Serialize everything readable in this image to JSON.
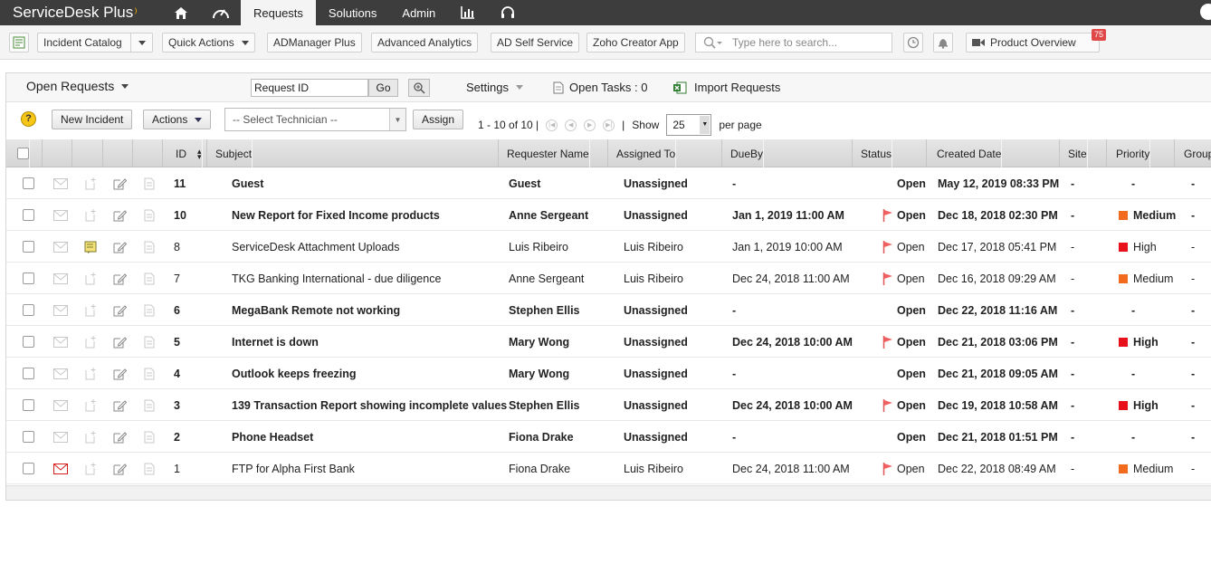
{
  "app": {
    "title": "ServiceDesk Plus"
  },
  "nav": {
    "tabs": [
      {
        "label": "Requests",
        "active": true
      },
      {
        "label": "Solutions"
      },
      {
        "label": "Admin"
      }
    ],
    "icons": [
      "home-icon",
      "dashboard-icon",
      "reports-icon",
      "support-icon"
    ]
  },
  "toolbar": {
    "incident_catalog": "Incident Catalog",
    "quick_actions": "Quick Actions",
    "admanager": "ADManager Plus",
    "advanced_analytics": "Advanced Analytics",
    "ad_self_service": "AD Self Service",
    "zoho_creator": "Zoho Creator App",
    "search_placeholder": "Type here to search...",
    "product_overview": "Product Overview",
    "notification_count": "75"
  },
  "panel": {
    "view_title": "Open Requests",
    "request_id_value": "Request ID",
    "go_label": "Go",
    "settings_label": "Settings",
    "open_tasks": "Open Tasks : 0",
    "import_requests": "Import Requests"
  },
  "actions": {
    "new_incident": "New Incident",
    "actions_label": "Actions",
    "technician_placeholder": "-- Select Technician --",
    "assign_label": "Assign",
    "page_info": "1 - 10 of 10",
    "show_label": "Show",
    "per_page_value": "25",
    "per_page_label": "per page"
  },
  "table": {
    "columns": {
      "id": "ID",
      "subject": "Subject",
      "requester": "Requester Name",
      "assigned": "Assigned To",
      "dueby": "DueBy",
      "status": "Status",
      "created": "Created Date",
      "site": "Site",
      "priority": "Priority",
      "group": "Group"
    },
    "rows": [
      {
        "id": "11",
        "subject": "Guest",
        "requester": "Guest",
        "assigned": "Unassigned",
        "dueby": "-",
        "flag": false,
        "status": "Open",
        "created": "May 12, 2019 08:33 PM",
        "site": "-",
        "priority": "-",
        "priority_color": "",
        "group": "-",
        "unread": true,
        "mail_red": false,
        "note": false
      },
      {
        "id": "10",
        "subject": "New Report for Fixed Income products",
        "requester": "Anne Sergeant",
        "assigned": "Unassigned",
        "dueby": "Jan 1, 2019 11:00 AM",
        "flag": true,
        "status": "Open",
        "created": "Dec 18, 2018 02:30 PM",
        "site": "-",
        "priority": "Medium",
        "priority_color": "#f26b1d",
        "group": "-",
        "unread": true,
        "mail_red": false,
        "note": false
      },
      {
        "id": "8",
        "subject": "ServiceDesk Attachment Uploads",
        "requester": "Luis Ribeiro",
        "assigned": "Luis Ribeiro",
        "dueby": "Jan 1, 2019 10:00 AM",
        "flag": true,
        "status": "Open",
        "created": "Dec 17, 2018 05:41 PM",
        "site": "-",
        "priority": "High",
        "priority_color": "#e8101a",
        "group": "-",
        "unread": false,
        "mail_red": false,
        "note": true
      },
      {
        "id": "7",
        "subject": "TKG Banking International - due diligence",
        "requester": "Anne Sergeant",
        "assigned": "Luis Ribeiro",
        "dueby": "Dec 24, 2018 11:00 AM",
        "flag": true,
        "status": "Open",
        "created": "Dec 16, 2018 09:29 AM",
        "site": "-",
        "priority": "Medium",
        "priority_color": "#f26b1d",
        "group": "-",
        "unread": false,
        "mail_red": false,
        "note": false
      },
      {
        "id": "6",
        "subject": "MegaBank Remote not working",
        "requester": "Stephen Ellis",
        "assigned": "Unassigned",
        "dueby": "-",
        "flag": false,
        "status": "Open",
        "created": "Dec 22, 2018 11:16 AM",
        "site": "-",
        "priority": "-",
        "priority_color": "",
        "group": "-",
        "unread": true,
        "mail_red": false,
        "note": false
      },
      {
        "id": "5",
        "subject": "Internet is down",
        "requester": "Mary Wong",
        "assigned": "Unassigned",
        "dueby": "Dec 24, 2018 10:00 AM",
        "flag": true,
        "status": "Open",
        "created": "Dec 21, 2018 03:06 PM",
        "site": "-",
        "priority": "High",
        "priority_color": "#e8101a",
        "group": "-",
        "unread": true,
        "mail_red": false,
        "note": false
      },
      {
        "id": "4",
        "subject": "Outlook keeps freezing",
        "requester": "Mary Wong",
        "assigned": "Unassigned",
        "dueby": "-",
        "flag": false,
        "status": "Open",
        "created": "Dec 21, 2018 09:05 AM",
        "site": "-",
        "priority": "-",
        "priority_color": "",
        "group": "-",
        "unread": true,
        "mail_red": false,
        "note": false
      },
      {
        "id": "3",
        "subject": "139 Transaction Report showing incomplete values",
        "requester": "Stephen Ellis",
        "assigned": "Unassigned",
        "dueby": "Dec 24, 2018 10:00 AM",
        "flag": true,
        "status": "Open",
        "created": "Dec 19, 2018 10:58 AM",
        "site": "-",
        "priority": "High",
        "priority_color": "#e8101a",
        "group": "-",
        "unread": true,
        "mail_red": false,
        "note": false
      },
      {
        "id": "2",
        "subject": "Phone Headset",
        "requester": "Fiona Drake",
        "assigned": "Unassigned",
        "dueby": "-",
        "flag": false,
        "status": "Open",
        "created": "Dec 21, 2018 01:51 PM",
        "site": "-",
        "priority": "-",
        "priority_color": "",
        "group": "-",
        "unread": true,
        "mail_red": false,
        "note": false
      },
      {
        "id": "1",
        "subject": "FTP for Alpha First Bank",
        "requester": "Fiona Drake",
        "assigned": "Luis Ribeiro",
        "dueby": "Dec 24, 2018 11:00 AM",
        "flag": true,
        "status": "Open",
        "created": "Dec 22, 2018 08:49 AM",
        "site": "-",
        "priority": "Medium",
        "priority_color": "#f26b1d",
        "group": "-",
        "unread": false,
        "mail_red": true,
        "note": false
      }
    ]
  }
}
